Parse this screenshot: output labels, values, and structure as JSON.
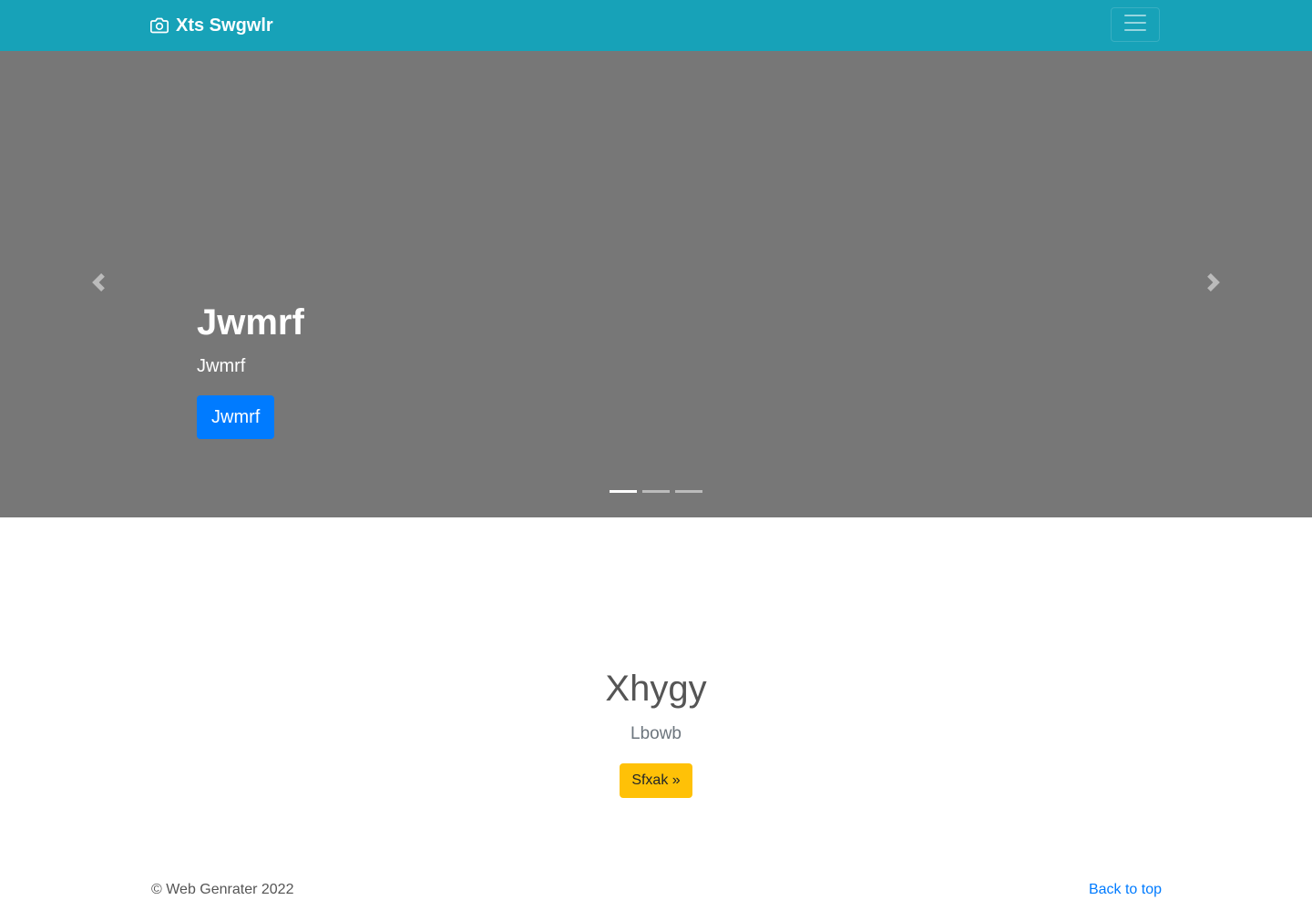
{
  "navbar": {
    "brand": "Xts Swgwlr",
    "brand_icon": "camera-icon",
    "toggler_icon": "hamburger-icon",
    "color": "#17a2b8"
  },
  "carousel": {
    "background": "#777777",
    "slide": {
      "title": "Jwmrf",
      "text": "Jwmrf",
      "button": "Jwmrf"
    },
    "indicators": 3,
    "active_indicator": 0,
    "prev_icon": "chevron-left-icon",
    "next_icon": "chevron-right-icon"
  },
  "jumbotron": {
    "title": "Xhygy",
    "subtitle": "Lbowb",
    "button": "Sfxak »"
  },
  "footer": {
    "copyright": "© Web Genrater 2022",
    "back_to_top": "Back to top"
  },
  "colors": {
    "primary": "#007bff",
    "warning": "#ffc107"
  }
}
